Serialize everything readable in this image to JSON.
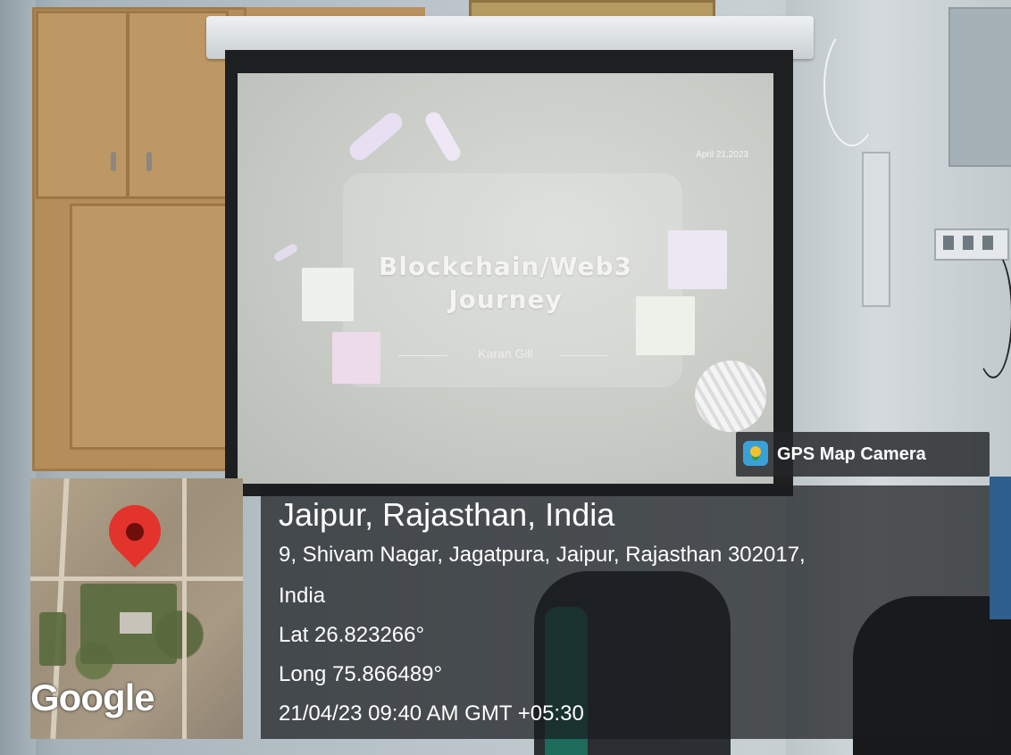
{
  "slide": {
    "title_line1": "Blockchain/Web3",
    "title_line2": "Journey",
    "author": "Karan Gill",
    "date": "April 21,2023"
  },
  "overlay": {
    "app_name": "GPS Map Camera",
    "place": "Jaipur, Rajasthan, India",
    "address_line1": "9, Shivam Nagar, Jagatpura, Jaipur, Rajasthan 302017,",
    "address_line2": "India",
    "latitude": "Lat 26.823266°",
    "longitude": "Long 75.866489°",
    "datetime": "21/04/23 09:40 AM GMT +05:30",
    "map_brand": "Google"
  },
  "colors": {
    "pin": "#e3332d",
    "overlay_bg": "#191c1f",
    "screen": "#c9ccc6"
  },
  "icons": [
    "map-pin-icon",
    "gps-map-camera-logo-icon"
  ]
}
